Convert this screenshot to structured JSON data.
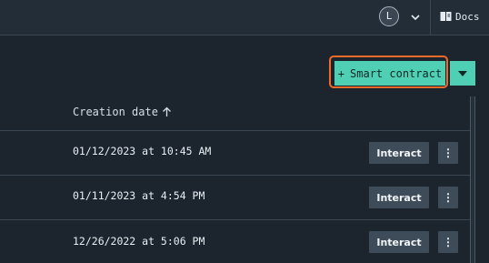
{
  "header": {
    "avatar_initial": "L",
    "docs_label": "Docs"
  },
  "toolbar": {
    "primary_plus": "+",
    "primary_label": "Smart contract"
  },
  "table": {
    "column_header": "Creation date",
    "rows": [
      {
        "date": "01/12/2023 at 10:45 AM",
        "action_label": "Interact",
        "more": "⋮"
      },
      {
        "date": "01/11/2023 at 4:54 PM",
        "action_label": "Interact",
        "more": "⋮"
      },
      {
        "date": "12/26/2022 at 5:06 PM",
        "action_label": "Interact",
        "more": "⋮"
      }
    ]
  },
  "colors": {
    "accent": "#4fcfb4",
    "highlight": "#f06a28",
    "background": "#1c252e"
  }
}
